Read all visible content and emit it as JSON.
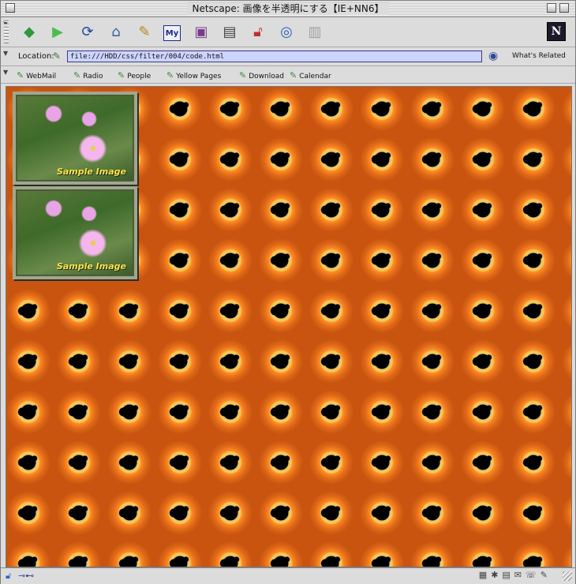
{
  "window": {
    "title": "Netscape: 画像を半透明にする【IE+NN6】"
  },
  "navigation_toolbar": {
    "icons": [
      "back-icon",
      "forward-icon",
      "reload-icon",
      "home-icon",
      "search-icon",
      "my-netscape-icon",
      "images-icon",
      "print-icon",
      "security-icon",
      "shop-icon",
      "stop-icon"
    ],
    "my_netscape_label": "My",
    "logo_letter": "N"
  },
  "location_bar": {
    "label": "Location:",
    "url": "file:///HDD/css/filter/004/code.html",
    "related_label": "What's Related"
  },
  "personal_toolbar": {
    "items": [
      {
        "label": "WebMail"
      },
      {
        "label": "Radio"
      },
      {
        "label": "People"
      },
      {
        "label": "Yellow Pages"
      },
      {
        "label": "Download"
      },
      {
        "label": "Calendar"
      }
    ]
  },
  "content": {
    "images": [
      {
        "caption": "Sample Image"
      },
      {
        "caption": "Sample Image"
      }
    ]
  },
  "colors": {
    "background_orange": "#c85410",
    "caption_yellow": "#f6e640",
    "url_field": "#ccd4ff"
  }
}
